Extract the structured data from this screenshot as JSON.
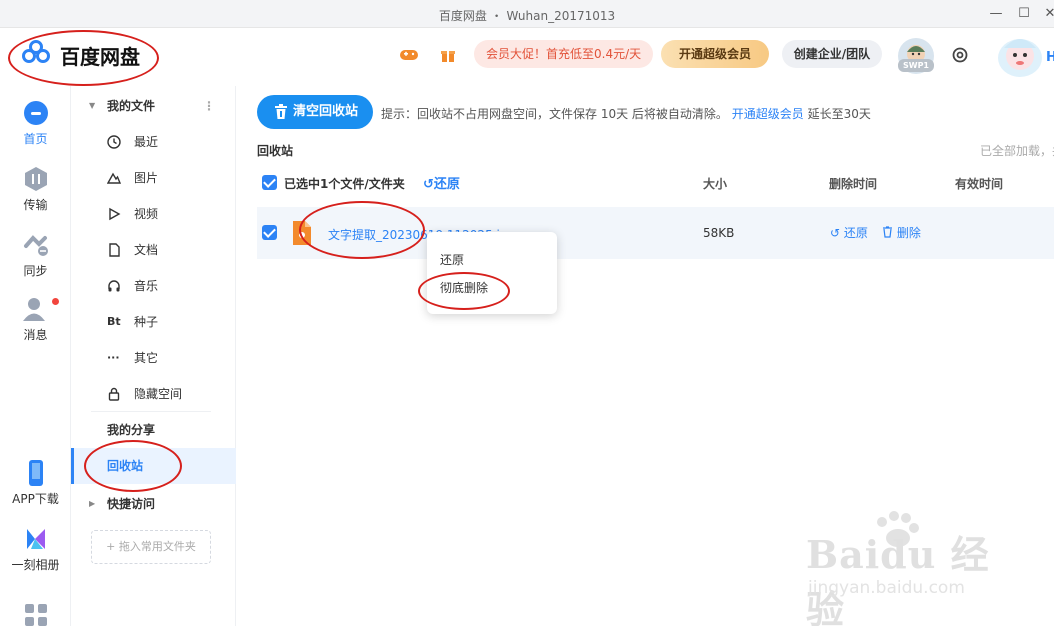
{
  "window": {
    "title": "百度网盘 ・ Wuhan_20171013"
  },
  "header": {
    "logo_text": "百度网盘",
    "promo": "会员大促！首充低至0.4元/天",
    "super_vip_button": "开通超级会员",
    "team_button": "创建企业/团队",
    "avatar_badge": "SWP1",
    "mascot_letter": "H"
  },
  "rail": {
    "items": [
      {
        "label": "首页"
      },
      {
        "label": "传输"
      },
      {
        "label": "同步"
      },
      {
        "label": "消息"
      },
      {
        "label": "APP下载"
      },
      {
        "label": "一刻相册"
      }
    ]
  },
  "sidebar": {
    "my_files": "我的文件",
    "items": [
      {
        "label": "最近"
      },
      {
        "label": "图片"
      },
      {
        "label": "视频"
      },
      {
        "label": "文档"
      },
      {
        "label": "音乐"
      },
      {
        "label": "种子"
      },
      {
        "label": "其它"
      },
      {
        "label": "隐藏空间"
      }
    ],
    "bt_glyph": "Bt",
    "my_share": "我的分享",
    "recycle_bin": "回收站",
    "quick_access": "快捷访问",
    "drop_hint": "+ 拖入常用文件夹"
  },
  "main": {
    "clear_button": "清空回收站",
    "tip_prefix": "提示：回收站不占用网盘空间，文件保存 10天 后将被自动清除。",
    "tip_link": "开通超级会员",
    "tip_suffix": " 延长至30天",
    "breadcrumb": "回收站",
    "loaded_text": "已全部加载，共",
    "table": {
      "selected_text": "已选中1个文件/文件夹",
      "restore_all": "还原",
      "col_size": "大小",
      "col_deleted": "删除时间",
      "col_valid": "有效时间"
    },
    "rows": [
      {
        "name": "文字提取_20230619 112025.jpg",
        "size": "58KB",
        "restore": "还原",
        "delete": "删除"
      }
    ]
  },
  "context_menu": {
    "items": [
      {
        "label": "还原"
      },
      {
        "label": "彻底删除"
      }
    ]
  },
  "watermark": {
    "main": "Baidu 经验",
    "sub": "jingyan.baidu.com"
  },
  "colors": {
    "accent": "#2c83f5",
    "annotation": "#d6201c",
    "promo": "#e2533a"
  }
}
